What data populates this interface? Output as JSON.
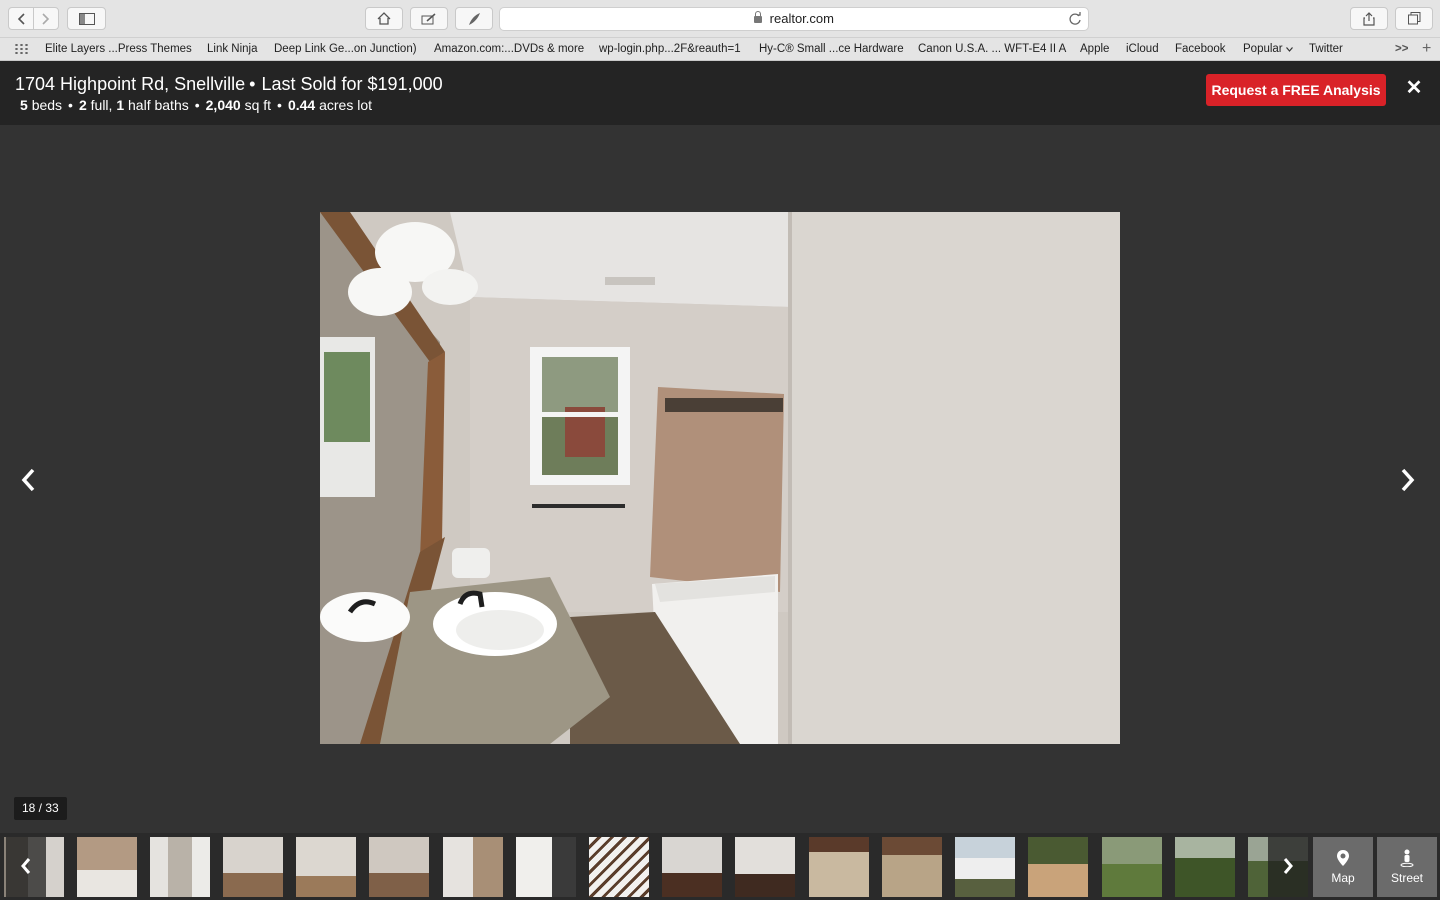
{
  "browser": {
    "url": "realtor.com",
    "bookmarks": [
      "Elite Layers ...Press Themes",
      "Link Ninja",
      "Deep Link Ge...on Junction)",
      "Amazon.com:...DVDs & more",
      "wp-login.php...2F&reauth=1",
      "Hy-C® Small ...ce Hardware",
      "Canon U.S.A. ... WFT-E4 II A",
      "Apple",
      "iCloud",
      "Facebook",
      "Popular",
      "Twitter"
    ],
    "more_bookmarks": ">>",
    "new_tab": "+"
  },
  "listing": {
    "address": "1704 Highpoint Rd, Snellville",
    "bullet": "•",
    "sold": "Last Sold for $191,000",
    "beds_num": "5",
    "beds_label": "beds",
    "full_num": "2",
    "full_label": "full,",
    "half_num": "1",
    "half_label": "half baths",
    "sqft_num": "2,040",
    "sqft_label": "sq ft",
    "lot_num": "0.44",
    "lot_label": "acres lot"
  },
  "header": {
    "cta_label": "Request a FREE Analysis",
    "close_label": "✕"
  },
  "gallery": {
    "counter": "18 / 33",
    "current_index": 18,
    "total": 33
  },
  "strip": {
    "map_label": "Map",
    "street_label": "Street"
  },
  "colors": {
    "accent": "#d92228",
    "header_bg": "#242424",
    "viewer_bg": "#333333"
  }
}
